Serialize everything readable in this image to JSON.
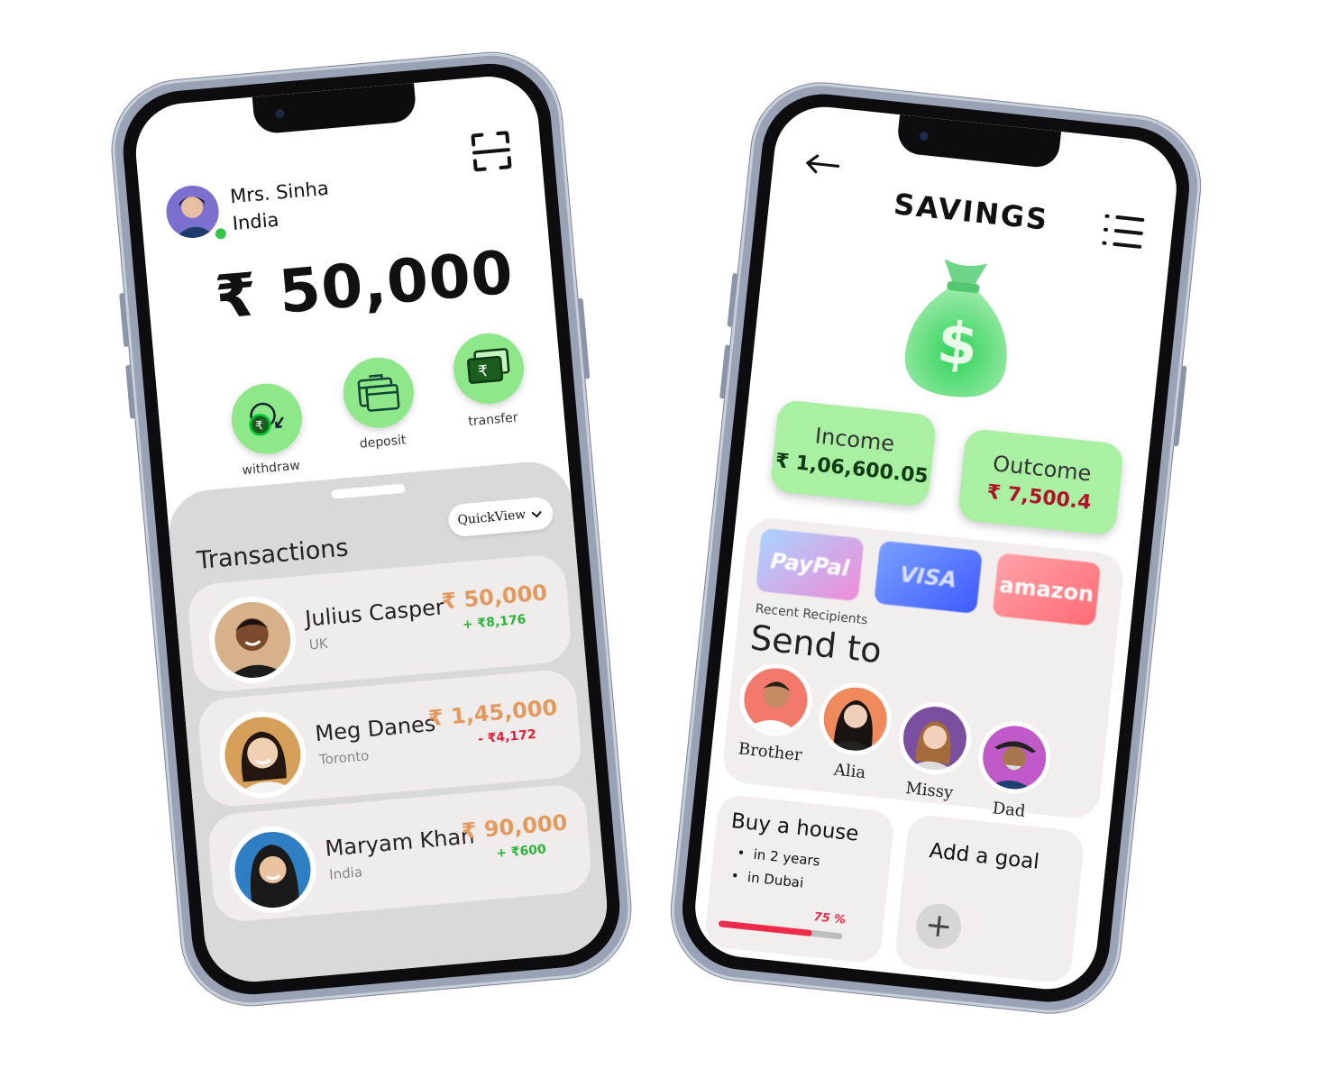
{
  "left_phone": {
    "user_name": "Mrs. Sinha",
    "user_country": "India",
    "balance": "₹ 50,000",
    "actions": [
      {
        "label": "withdraw"
      },
      {
        "label": "deposit"
      },
      {
        "label": "transfer"
      }
    ],
    "transactions_title": "Transactions",
    "quickview_label": "QuickView",
    "transactions": [
      {
        "name": "Julius Casper",
        "location": "UK",
        "amount": "₹ 50,000",
        "change": "+ ₹8,176",
        "change_color": "#2bb33a"
      },
      {
        "name": "Meg Danes",
        "location": "Toronto",
        "amount": "₹ 1,45,000",
        "change": "- ₹4,172",
        "change_color": "#e0223a"
      },
      {
        "name": "Maryam Khan",
        "location": "India",
        "amount": "₹ 90,000",
        "change": "+ ₹600",
        "change_color": "#2bb33a"
      }
    ]
  },
  "right_phone": {
    "title": "SAVINGS",
    "income_label": "Income",
    "income_value": "₹ 1,06,600.05",
    "outcome_label": "Outcome",
    "outcome_value": "₹ 7,500.4",
    "cards": [
      {
        "label": "PayPal"
      },
      {
        "label": "VISA"
      },
      {
        "label": "amazon"
      }
    ],
    "recent_label": "Recent Recipients",
    "send_to_label": "Send to",
    "recipients": [
      {
        "label": "Brother"
      },
      {
        "label": "Alia"
      },
      {
        "label": "Missy"
      },
      {
        "label": "Dad"
      }
    ],
    "goal_title": "Buy a house",
    "goal_bullets": [
      "in 2 years",
      "in Dubai"
    ],
    "goal_progress": 0.75,
    "goal_progress_label": "75 %",
    "add_goal_label": "Add a goal"
  },
  "colors": {
    "accent_green": "#8ee88a",
    "amount_orange": "#e39a5f",
    "outcome_red": "#b0122a",
    "income_text": "#0e3a14",
    "progress_red": "#ef2a4a"
  },
  "icons": [
    "scan-icon",
    "rupee-withdraw-icon",
    "wallet-deposit-icon",
    "rupee-transfer-icon",
    "chevron-down-icon",
    "back-arrow-icon",
    "menu-list-icon",
    "money-bag-icon",
    "plus-icon"
  ]
}
